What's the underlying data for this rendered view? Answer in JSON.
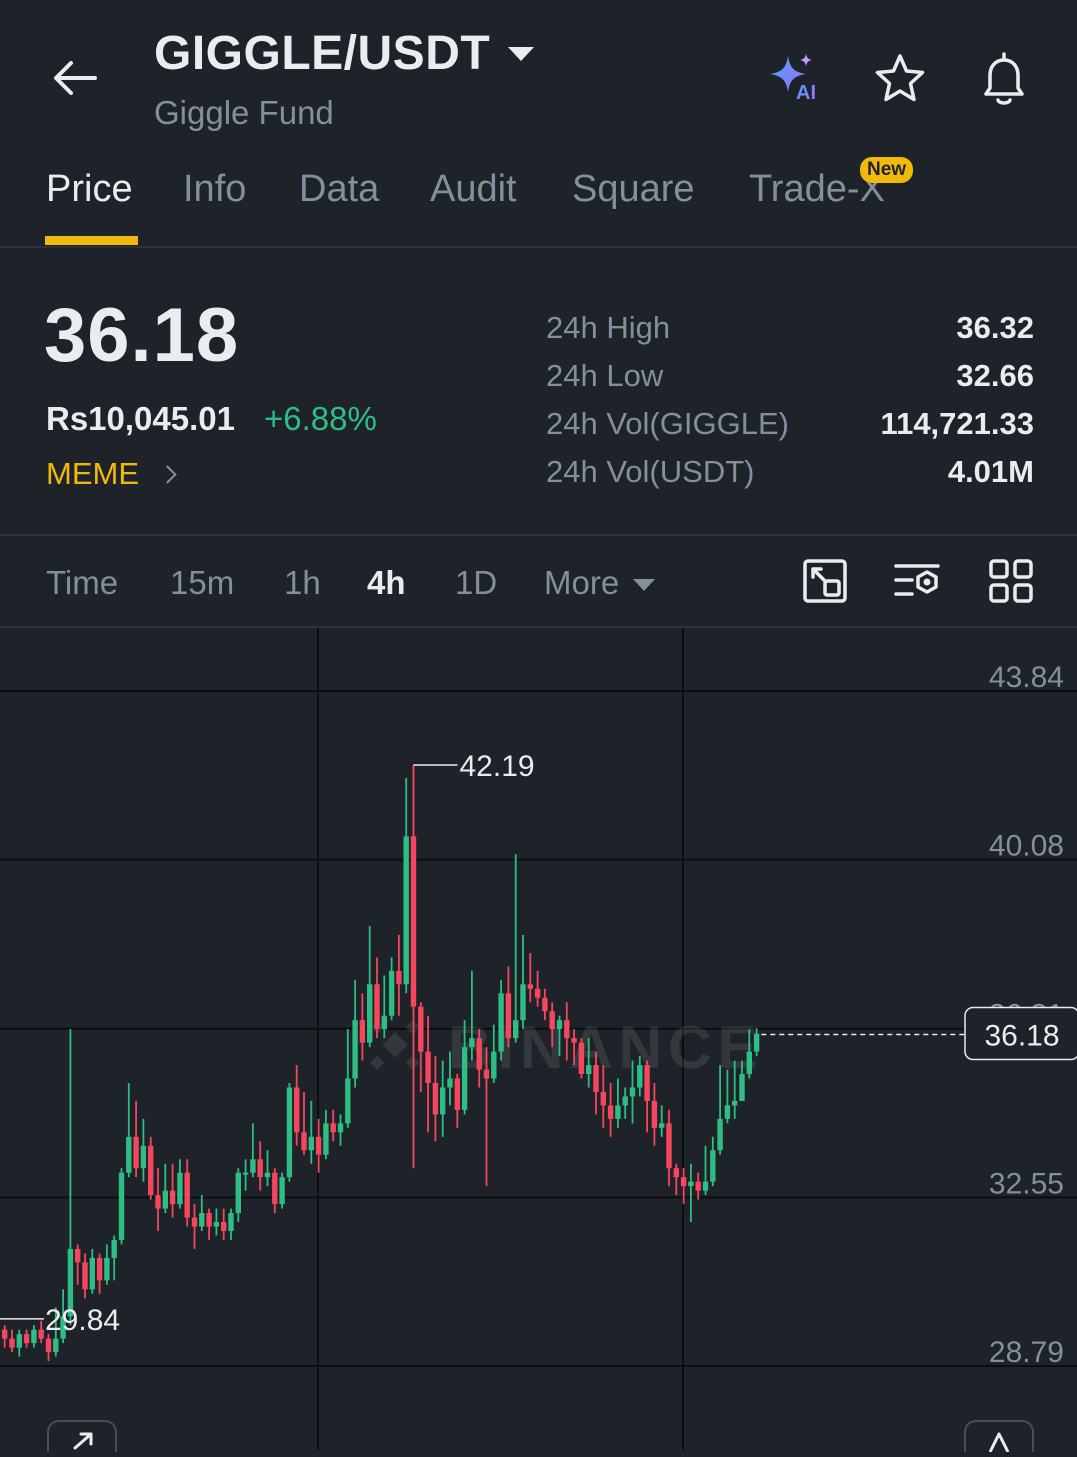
{
  "header": {
    "pair": "GIGGLE/USDT",
    "subtitle": "Giggle Fund",
    "ai_label": "AI"
  },
  "tabs": [
    {
      "label": "Price",
      "active": true
    },
    {
      "label": "Info",
      "active": false
    },
    {
      "label": "Data",
      "active": false
    },
    {
      "label": "Audit",
      "active": false
    },
    {
      "label": "Square",
      "active": false
    },
    {
      "label": "Trade-X",
      "active": false,
      "badge": "New"
    }
  ],
  "price": {
    "last": "36.18",
    "fiat": "Rs10,045.01",
    "change": "+6.88%",
    "tag": "MEME"
  },
  "stats": [
    {
      "label": "24h High",
      "value": "36.32"
    },
    {
      "label": "24h Low",
      "value": "32.66"
    },
    {
      "label": "24h Vol(GIGGLE)",
      "value": "114,721.33"
    },
    {
      "label": "24h Vol(USDT)",
      "value": "4.01M"
    }
  ],
  "intervals": {
    "items": [
      "Time",
      "15m",
      "1h",
      "4h",
      "1D"
    ],
    "active": "4h",
    "more": "More"
  },
  "colors": {
    "up": "#2ebd85",
    "down": "#f6465d",
    "accent": "#f0b90b",
    "background": "#1e2329",
    "text_muted": "#848e9c"
  },
  "chart_data": {
    "type": "candlestick",
    "interval": "4h",
    "y_axis_ticks": [
      "43.84",
      "40.08",
      "36.31",
      "32.55",
      "28.79"
    ],
    "ylim": [
      28.79,
      43.84
    ],
    "high_marker": "42.19",
    "low_marker": "29.84",
    "current_price_label": "36.18",
    "watermark": "BINANCE",
    "candles": [
      [
        29.6,
        29.4,
        29.7,
        29.2
      ],
      [
        29.4,
        29.2,
        29.6,
        29.1
      ],
      [
        29.2,
        29.5,
        29.6,
        29.0
      ],
      [
        29.5,
        29.3,
        29.6,
        29.2
      ],
      [
        29.3,
        29.6,
        29.7,
        29.2
      ],
      [
        29.6,
        29.4,
        29.8,
        29.3
      ],
      [
        29.4,
        29.1,
        29.5,
        28.9
      ],
      [
        29.1,
        29.4,
        30.1,
        29.0
      ],
      [
        29.4,
        29.9,
        30.5,
        29.3
      ],
      [
        29.9,
        31.4,
        36.3,
        29.7
      ],
      [
        31.4,
        31.1,
        31.5,
        30.6
      ],
      [
        31.1,
        30.5,
        31.3,
        30.3
      ],
      [
        30.5,
        31.2,
        31.4,
        30.4
      ],
      [
        31.2,
        30.7,
        31.3,
        30.4
      ],
      [
        30.7,
        31.2,
        31.5,
        30.6
      ],
      [
        31.2,
        31.6,
        31.7,
        30.7
      ],
      [
        31.6,
        33.1,
        33.2,
        31.5
      ],
      [
        33.1,
        33.9,
        35.1,
        33.0
      ],
      [
        33.9,
        33.2,
        34.7,
        33.0
      ],
      [
        33.2,
        33.7,
        34.3,
        32.9
      ],
      [
        33.7,
        32.6,
        33.9,
        32.5
      ],
      [
        32.6,
        32.3,
        33.2,
        31.8
      ],
      [
        32.3,
        32.7,
        33.3,
        32.2
      ],
      [
        32.7,
        32.4,
        33.3,
        32.1
      ],
      [
        32.4,
        33.1,
        33.4,
        32.3
      ],
      [
        33.1,
        32.1,
        33.4,
        31.9
      ],
      [
        32.1,
        31.9,
        32.4,
        31.4
      ],
      [
        31.9,
        32.2,
        32.6,
        31.8
      ],
      [
        32.2,
        31.9,
        32.3,
        31.6
      ],
      [
        31.9,
        32.0,
        32.3,
        31.7
      ],
      [
        32.0,
        31.8,
        32.3,
        31.6
      ],
      [
        31.8,
        32.2,
        32.3,
        31.6
      ],
      [
        32.2,
        33.1,
        33.2,
        32.0
      ],
      [
        33.1,
        33.1,
        33.4,
        32.7
      ],
      [
        33.1,
        33.4,
        34.2,
        33.0
      ],
      [
        33.4,
        33.0,
        33.8,
        32.7
      ],
      [
        33.0,
        33.1,
        33.6,
        32.8
      ],
      [
        33.1,
        32.4,
        33.2,
        32.2
      ],
      [
        32.4,
        33.0,
        33.1,
        32.3
      ],
      [
        33.0,
        35.0,
        35.1,
        32.9
      ],
      [
        35.0,
        34.0,
        35.5,
        33.7
      ],
      [
        34.0,
        33.6,
        34.9,
        33.5
      ],
      [
        33.6,
        33.9,
        34.7,
        33.3
      ],
      [
        33.9,
        33.5,
        34.3,
        33.1
      ],
      [
        33.5,
        34.2,
        34.5,
        33.4
      ],
      [
        34.2,
        34.0,
        34.5,
        33.8
      ],
      [
        34.0,
        34.2,
        34.4,
        33.7
      ],
      [
        34.2,
        35.2,
        36.3,
        34.1
      ],
      [
        35.2,
        36.5,
        37.4,
        35.0
      ],
      [
        36.5,
        36.0,
        37.1,
        35.6
      ],
      [
        36.0,
        37.3,
        38.6,
        35.9
      ],
      [
        37.3,
        36.3,
        37.9,
        36.1
      ],
      [
        36.3,
        36.6,
        37.5,
        36.1
      ],
      [
        36.6,
        37.6,
        37.9,
        36.5
      ],
      [
        37.6,
        37.3,
        38.4,
        36.6
      ],
      [
        37.3,
        40.6,
        41.9,
        37.1
      ],
      [
        40.6,
        36.8,
        42.19,
        33.2
      ],
      [
        36.8,
        35.8,
        36.9,
        34.9
      ],
      [
        35.8,
        35.1,
        36.6,
        34.0
      ],
      [
        35.1,
        34.4,
        35.7,
        33.8
      ],
      [
        34.4,
        35.0,
        35.6,
        33.9
      ],
      [
        35.0,
        35.2,
        35.8,
        34.6
      ],
      [
        35.2,
        34.5,
        35.3,
        34.1
      ],
      [
        34.5,
        35.9,
        36.5,
        34.4
      ],
      [
        35.9,
        36.1,
        37.6,
        35.6
      ],
      [
        36.1,
        35.4,
        36.3,
        35.0
      ],
      [
        35.4,
        35.2,
        35.9,
        32.8
      ],
      [
        35.2,
        35.8,
        36.4,
        35.1
      ],
      [
        35.8,
        37.1,
        37.4,
        35.6
      ],
      [
        37.1,
        36.1,
        37.7,
        35.9
      ],
      [
        36.1,
        36.5,
        40.2,
        36.0
      ],
      [
        36.5,
        37.3,
        38.4,
        36.3
      ],
      [
        37.3,
        37.2,
        38.0,
        36.9
      ],
      [
        37.2,
        37.0,
        37.6,
        36.8
      ],
      [
        37.0,
        36.7,
        37.2,
        36.5
      ],
      [
        36.7,
        36.3,
        36.9,
        35.9
      ],
      [
        36.3,
        36.5,
        36.6,
        35.7
      ],
      [
        36.5,
        36.1,
        36.9,
        35.6
      ],
      [
        36.1,
        36.0,
        36.3,
        35.5
      ],
      [
        36.0,
        35.3,
        36.1,
        35.2
      ],
      [
        35.3,
        35.5,
        36.1,
        35.0
      ],
      [
        35.5,
        34.9,
        35.8,
        34.4
      ],
      [
        34.9,
        34.6,
        35.5,
        34.1
      ],
      [
        34.6,
        34.3,
        35.1,
        33.9
      ],
      [
        34.3,
        34.6,
        35.2,
        34.1
      ],
      [
        34.6,
        34.8,
        35.0,
        34.3
      ],
      [
        34.8,
        35.0,
        35.6,
        34.2
      ],
      [
        35.0,
        35.5,
        35.7,
        34.8
      ],
      [
        35.5,
        34.7,
        35.6,
        34.0
      ],
      [
        34.7,
        34.1,
        35.1,
        33.7
      ],
      [
        34.1,
        34.2,
        34.6,
        33.9
      ],
      [
        34.2,
        33.2,
        34.5,
        32.8
      ],
      [
        33.2,
        33.0,
        33.3,
        32.6
      ],
      [
        33.0,
        32.8,
        33.2,
        32.4
      ],
      [
        32.8,
        32.9,
        33.3,
        32.0
      ],
      [
        32.9,
        32.7,
        33.1,
        32.5
      ],
      [
        32.7,
        32.9,
        33.7,
        32.6
      ],
      [
        32.9,
        33.6,
        33.9,
        32.8
      ],
      [
        33.6,
        34.3,
        35.5,
        33.5
      ],
      [
        34.3,
        34.6,
        35.4,
        34.2
      ],
      [
        34.6,
        34.7,
        35.6,
        34.3
      ],
      [
        34.7,
        35.3,
        35.6,
        34.7
      ],
      [
        35.3,
        35.8,
        36.3,
        35.2
      ],
      [
        35.8,
        36.2,
        36.32,
        35.7
      ]
    ]
  }
}
